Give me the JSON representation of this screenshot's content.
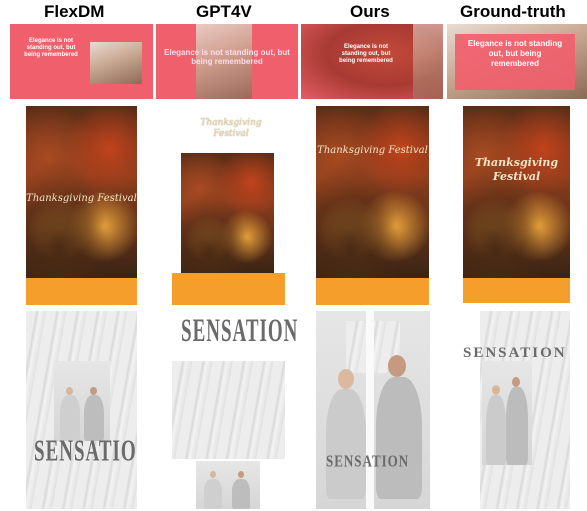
{
  "headers": [
    "FlexDM",
    "GPT4V",
    "Ours",
    "Ground-truth"
  ],
  "row1_text": {
    "flexdm": "Elegance is not standing out, but being remembered",
    "gpt4v": "Elegance is not standing out, but being remembered",
    "ours": "Elegance is not standing out, but being remembered",
    "gt": "Elegance is not standing out, but being remembered"
  },
  "row2_text": {
    "flexdm": "Thanksgiving Festival",
    "gpt4v": "Thanksgiving Festival",
    "ours": "Thanksgiving Festival",
    "gt": "Thanksgiving Festival"
  },
  "row3_text": {
    "flexdm": "SENSATION",
    "gpt4v": "SENSATION",
    "ours": "SENSATION",
    "gt": "SENSATION"
  },
  "colors": {
    "pink": "#f0606c",
    "orange": "#f59e2c"
  }
}
